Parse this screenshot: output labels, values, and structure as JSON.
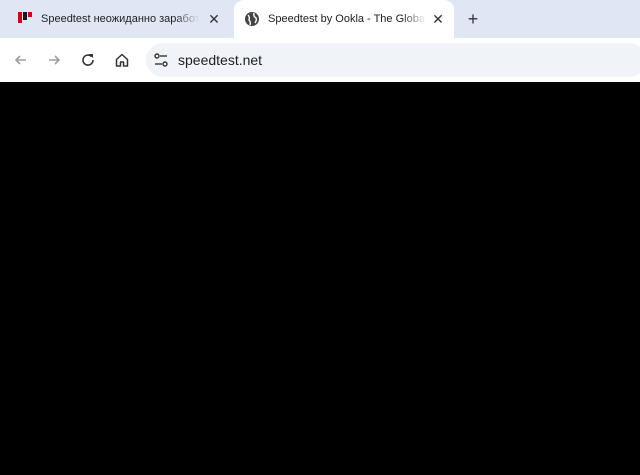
{
  "tabs": [
    {
      "title": "Speedtest неожиданно заработал",
      "favicon": "site-logo-icon"
    },
    {
      "title": "Speedtest by Ookla - The Global Broadband",
      "favicon": "globe-icon",
      "active": true
    }
  ],
  "new_tab": "+",
  "close_glyph": "✕",
  "omnibox": {
    "url": "speedtest.net"
  },
  "colors": {
    "tabstrip": "#dfe7f5",
    "toolbar": "#ffffff",
    "omnibox": "#f0f4f9",
    "content": "#000000"
  }
}
